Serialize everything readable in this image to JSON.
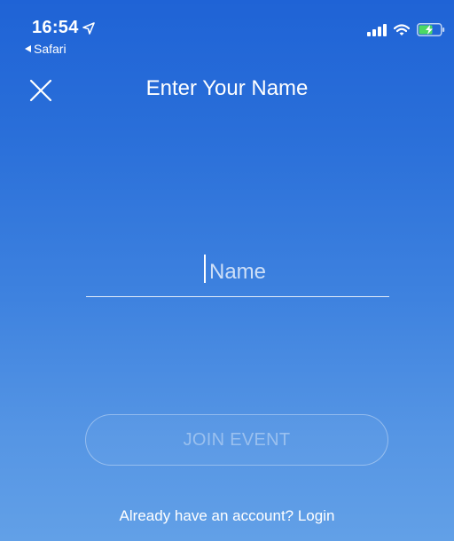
{
  "status_bar": {
    "time": "16:54",
    "back_app": "Safari",
    "icons": [
      "location-arrow-icon",
      "signal-bars-icon",
      "wifi-icon",
      "battery-charging-icon"
    ]
  },
  "nav": {
    "close_icon": "close-icon",
    "title": "Enter Your Name"
  },
  "form": {
    "name_value": "",
    "name_placeholder": "Name",
    "join_label": "JOIN EVENT",
    "login_label": "Already have an account? Login"
  },
  "colors": {
    "gradient_top": "#1f63d6",
    "gradient_bottom": "#62a0e7",
    "battery_fill": "#4cd964"
  }
}
